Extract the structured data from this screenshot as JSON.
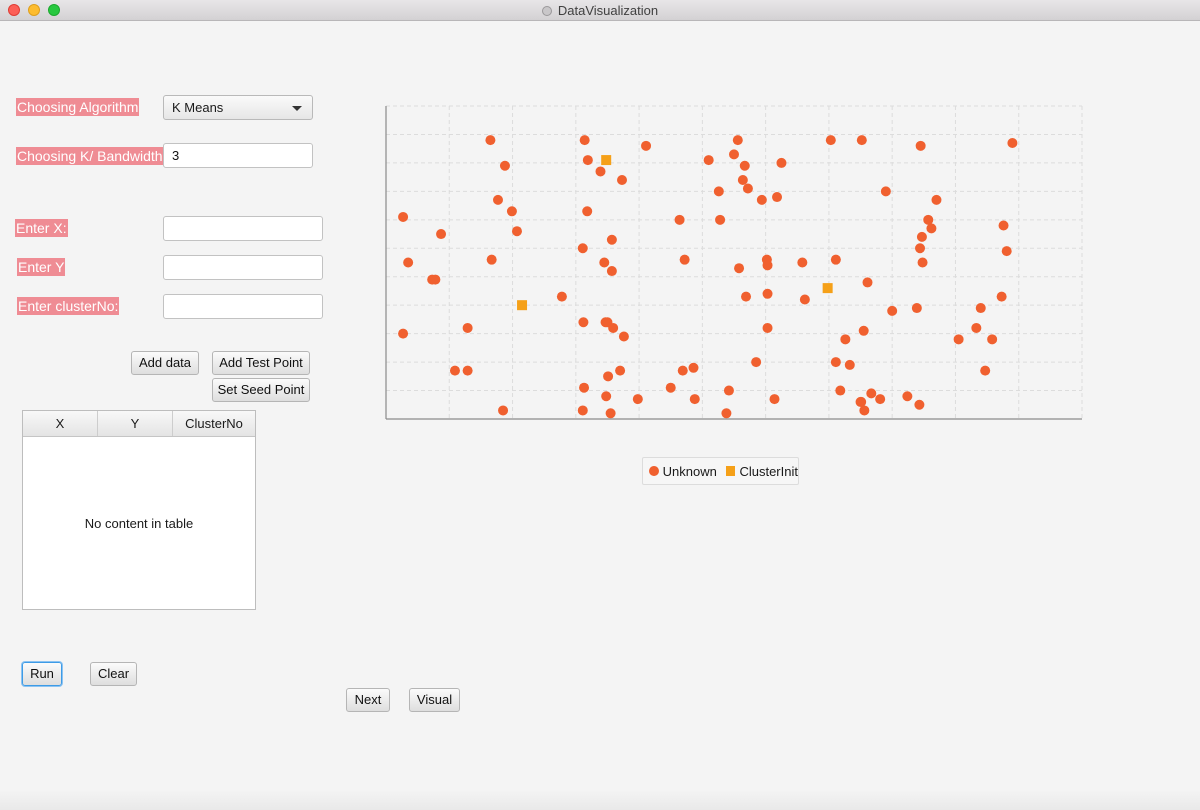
{
  "window": {
    "title": "DataVisualization"
  },
  "form": {
    "algorithm_label": "Choosing Algorithm",
    "algorithm_value": "K Means",
    "k_label": "Choosing K/ Bandwidth",
    "k_value": "3",
    "x_label": "Enter X:",
    "x_value": "",
    "y_label": "Enter Y",
    "y_value": "",
    "cluster_label": "Enter clusterNo:",
    "cluster_value": ""
  },
  "buttons": {
    "add_data": "Add data",
    "add_test_point": "Add Test Point",
    "set_seed_point": "Set Seed Point",
    "run": "Run",
    "clear": "Clear",
    "next": "Next",
    "visual": "Visual"
  },
  "table": {
    "columns": [
      "X",
      "Y",
      "ClusterNo"
    ],
    "empty_message": "No content in table"
  },
  "colors": {
    "label_bg": "#ef8c94",
    "series_unknown": "#f0602f",
    "series_clusterinit": "#f5a018",
    "focus_ring": "#3d9be6"
  },
  "chart_data": {
    "type": "scatter",
    "title": "",
    "xlabel": "",
    "ylabel": "",
    "xlim": [
      0,
      11
    ],
    "ylim": [
      0,
      11
    ],
    "grid": true,
    "legend": "bottom-center",
    "series": [
      {
        "name": "Unknown",
        "marker": "circle",
        "color": "#f0602f",
        "points": [
          [
            1.65,
            9.8
          ],
          [
            1.88,
            8.9
          ],
          [
            1.77,
            7.7
          ],
          [
            1.99,
            7.3
          ],
          [
            2.07,
            6.6
          ],
          [
            1.67,
            5.6
          ],
          [
            0.73,
            4.9
          ],
          [
            0.78,
            4.9
          ],
          [
            0.27,
            3.0
          ],
          [
            0.35,
            5.5
          ],
          [
            0.87,
            6.5
          ],
          [
            0.27,
            7.1
          ],
          [
            3.18,
            7.3
          ],
          [
            3.45,
            5.5
          ],
          [
            3.57,
            5.2
          ],
          [
            3.47,
            3.4
          ],
          [
            2.78,
            4.3
          ],
          [
            1.29,
            3.2
          ],
          [
            1.09,
            1.7
          ],
          [
            1.29,
            1.7
          ],
          [
            1.85,
            0.3
          ],
          [
            3.11,
            0.3
          ],
          [
            3.55,
            0.2
          ],
          [
            3.48,
            0.8
          ],
          [
            3.12,
            3.4
          ],
          [
            3.5,
            3.4
          ],
          [
            3.59,
            3.2
          ],
          [
            3.76,
            2.9
          ],
          [
            3.13,
            1.1
          ],
          [
            3.51,
            1.5
          ],
          [
            3.7,
            1.7
          ],
          [
            3.98,
            0.7
          ],
          [
            3.14,
            9.8
          ],
          [
            3.19,
            9.1
          ],
          [
            3.39,
            8.7
          ],
          [
            3.73,
            8.4
          ],
          [
            4.11,
            9.6
          ],
          [
            3.57,
            6.3
          ],
          [
            3.11,
            6.0
          ],
          [
            4.5,
            1.1
          ],
          [
            4.86,
            1.8
          ],
          [
            4.64,
            7.0
          ],
          [
            5.1,
            9.1
          ],
          [
            5.28,
            7.0
          ],
          [
            4.72,
            5.6
          ],
          [
            5.56,
            9.8
          ],
          [
            5.5,
            9.3
          ],
          [
            5.26,
            8.0
          ],
          [
            5.64,
            8.4
          ],
          [
            5.72,
            8.1
          ],
          [
            5.94,
            7.7
          ],
          [
            6.25,
            9.0
          ],
          [
            5.67,
            8.9
          ],
          [
            6.18,
            7.8
          ],
          [
            6.03,
            5.4
          ],
          [
            6.02,
            5.6
          ],
          [
            5.58,
            5.3
          ],
          [
            5.69,
            4.3
          ],
          [
            6.03,
            4.4
          ],
          [
            6.58,
            5.5
          ],
          [
            6.62,
            4.2
          ],
          [
            7.11,
            5.6
          ],
          [
            7.61,
            4.8
          ],
          [
            7.55,
            3.1
          ],
          [
            7.26,
            2.8
          ],
          [
            7.11,
            2.0
          ],
          [
            6.03,
            3.2
          ],
          [
            5.42,
            1.0
          ],
          [
            4.69,
            1.7
          ],
          [
            5.85,
            2.0
          ],
          [
            4.88,
            0.7
          ],
          [
            5.38,
            0.2
          ],
          [
            6.14,
            0.7
          ],
          [
            7.18,
            1.0
          ],
          [
            7.33,
            1.9
          ],
          [
            7.5,
            0.6
          ],
          [
            7.56,
            0.3
          ],
          [
            7.81,
            0.7
          ],
          [
            7.67,
            0.9
          ],
          [
            7.51,
            0.6
          ],
          [
            7.03,
            9.8
          ],
          [
            7.52,
            9.8
          ],
          [
            7.9,
            8.0
          ],
          [
            8.45,
            9.6
          ],
          [
            8.44,
            6.0
          ],
          [
            8.47,
            6.4
          ],
          [
            8.7,
            7.7
          ],
          [
            8.62,
            6.7
          ],
          [
            8.57,
            7.0
          ],
          [
            8.48,
            5.5
          ],
          [
            8.39,
            3.9
          ],
          [
            8.0,
            3.8
          ],
          [
            8.24,
            0.8
          ],
          [
            8.43,
            0.5
          ],
          [
            9.05,
            2.8
          ],
          [
            9.33,
            3.2
          ],
          [
            9.47,
            1.7
          ],
          [
            9.58,
            2.8
          ],
          [
            9.4,
            3.9
          ],
          [
            9.76,
            6.8
          ],
          [
            9.81,
            5.9
          ],
          [
            9.9,
            9.7
          ],
          [
            9.73,
            4.3
          ]
        ]
      },
      {
        "name": "ClusterInit",
        "marker": "square",
        "color": "#f5a018",
        "points": [
          [
            3.48,
            9.1
          ],
          [
            2.15,
            4.0
          ],
          [
            6.98,
            4.6
          ]
        ]
      }
    ]
  }
}
